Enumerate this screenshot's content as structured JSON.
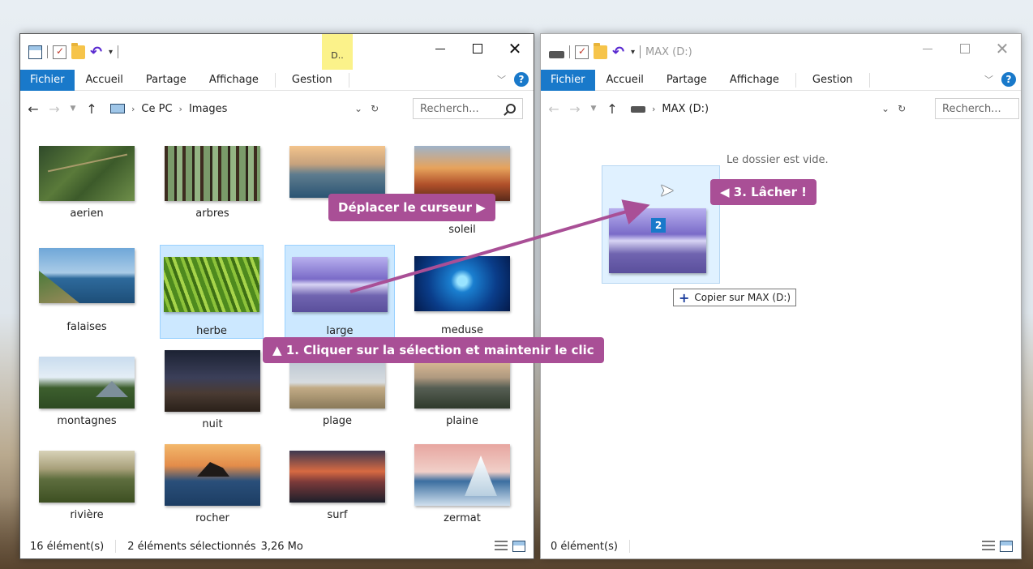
{
  "left_window": {
    "context_tab": "D..",
    "ribbon_tabs": [
      "Fichier",
      "Accueil",
      "Partage",
      "Affichage",
      "Gestion"
    ],
    "breadcrumb": [
      "Ce PC",
      "Images"
    ],
    "search_placeholder": "Recherch...",
    "files": [
      "aerien",
      "arbres",
      "",
      "soleil",
      "falaises",
      "herbe",
      "large",
      "meduse",
      "montagnes",
      "nuit",
      "plage",
      "plaine",
      "rivière",
      "rocher",
      "surf",
      "zermat"
    ],
    "selected_files": [
      "herbe",
      "large"
    ],
    "status": {
      "count": "16 élément(s)",
      "selection": "2 éléments sélectionnés",
      "size": "3,26 Mo"
    }
  },
  "right_window": {
    "title": "MAX (D:)",
    "ribbon_tabs": [
      "Fichier",
      "Accueil",
      "Partage",
      "Affichage",
      "Gestion"
    ],
    "breadcrumb": [
      "MAX (D:)"
    ],
    "search_placeholder": "Recherch...",
    "empty_message": "Le dossier est vide.",
    "drag_count": "2",
    "copy_tooltip": "Copier sur MAX (D:)",
    "status": {
      "count": "0 élément(s)"
    }
  },
  "callouts": {
    "step1": "1. Cliquer sur la sélection et maintenir le clic",
    "step2": "Déplacer le curseur",
    "step3": "3. Lâcher !"
  },
  "icons": {
    "step1": "▲",
    "step2": "▶",
    "step3": "◀"
  },
  "colors": {
    "accent": "#1979ca",
    "callout": "#a94f96",
    "selection": "#cce8ff"
  }
}
